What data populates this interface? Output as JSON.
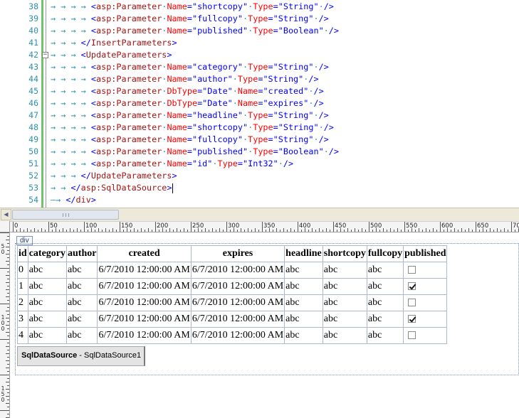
{
  "editor": {
    "lines": [
      {
        "n": "38",
        "indent": 4,
        "kind": "param",
        "attrs": [
          [
            "Name",
            "shortcopy"
          ],
          [
            "Type",
            "String"
          ]
        ]
      },
      {
        "n": "39",
        "indent": 4,
        "kind": "param",
        "attrs": [
          [
            "Name",
            "fullcopy"
          ],
          [
            "Type",
            "String"
          ]
        ]
      },
      {
        "n": "40",
        "indent": 4,
        "kind": "param",
        "attrs": [
          [
            "Name",
            "published"
          ],
          [
            "Type",
            "Boolean"
          ]
        ]
      },
      {
        "n": "41",
        "indent": 3,
        "kind": "close",
        "tag": "InsertParameters"
      },
      {
        "n": "42",
        "indent": 3,
        "kind": "open",
        "tag": "UpdateParameters",
        "fold": true
      },
      {
        "n": "43",
        "indent": 4,
        "kind": "param",
        "attrs": [
          [
            "Name",
            "category"
          ],
          [
            "Type",
            "String"
          ]
        ]
      },
      {
        "n": "44",
        "indent": 4,
        "kind": "param",
        "attrs": [
          [
            "Name",
            "author"
          ],
          [
            "Type",
            "String"
          ]
        ]
      },
      {
        "n": "45",
        "indent": 4,
        "kind": "param",
        "attrs": [
          [
            "DbType",
            "Date"
          ],
          [
            "Name",
            "created"
          ]
        ]
      },
      {
        "n": "46",
        "indent": 4,
        "kind": "param",
        "attrs": [
          [
            "DbType",
            "Date"
          ],
          [
            "Name",
            "expires"
          ]
        ]
      },
      {
        "n": "47",
        "indent": 4,
        "kind": "param",
        "attrs": [
          [
            "Name",
            "headline"
          ],
          [
            "Type",
            "String"
          ]
        ]
      },
      {
        "n": "48",
        "indent": 4,
        "kind": "param",
        "attrs": [
          [
            "Name",
            "shortcopy"
          ],
          [
            "Type",
            "String"
          ]
        ]
      },
      {
        "n": "49",
        "indent": 4,
        "kind": "param",
        "attrs": [
          [
            "Name",
            "fullcopy"
          ],
          [
            "Type",
            "String"
          ]
        ]
      },
      {
        "n": "50",
        "indent": 4,
        "kind": "param",
        "attrs": [
          [
            "Name",
            "published"
          ],
          [
            "Type",
            "Boolean"
          ]
        ]
      },
      {
        "n": "51",
        "indent": 4,
        "kind": "param",
        "attrs": [
          [
            "Name",
            "id"
          ],
          [
            "Type",
            "Int32"
          ]
        ]
      },
      {
        "n": "52",
        "indent": 3,
        "kind": "close",
        "tag": "UpdateParameters"
      },
      {
        "n": "53",
        "indent": 2,
        "kind": "close",
        "tag": "asp:SqlDataSource",
        "cursor": true
      },
      {
        "n": "54",
        "indent": 2,
        "kind": "close",
        "tag": "div",
        "leadDash": true
      }
    ],
    "param_tag": "asp:Parameter"
  },
  "ruler": {
    "labels": [
      "0",
      "50",
      "100",
      "150",
      "200",
      "250",
      "300",
      "350",
      "400",
      "450",
      "500",
      "550",
      "600",
      "650",
      "700"
    ],
    "vlabels": [
      "5",
      "0",
      "1",
      "0",
      "0",
      "1",
      "5",
      "0",
      "2",
      "0",
      "0",
      "2",
      "5",
      "0"
    ]
  },
  "design": {
    "div_tag": "div",
    "grid": {
      "headers": [
        "id",
        "category",
        "author",
        "created",
        "expires",
        "headline",
        "shortcopy",
        "fullcopy",
        "published"
      ],
      "rows": [
        {
          "id": "0",
          "category": "abc",
          "author": "abc",
          "created": "6/7/2010 12:00:00 AM",
          "expires": "6/7/2010 12:00:00 AM",
          "headline": "abc",
          "shortcopy": "abc",
          "fullcopy": "abc",
          "published": false
        },
        {
          "id": "1",
          "category": "abc",
          "author": "abc",
          "created": "6/7/2010 12:00:00 AM",
          "expires": "6/7/2010 12:00:00 AM",
          "headline": "abc",
          "shortcopy": "abc",
          "fullcopy": "abc",
          "published": true
        },
        {
          "id": "2",
          "category": "abc",
          "author": "abc",
          "created": "6/7/2010 12:00:00 AM",
          "expires": "6/7/2010 12:00:00 AM",
          "headline": "abc",
          "shortcopy": "abc",
          "fullcopy": "abc",
          "published": false
        },
        {
          "id": "3",
          "category": "abc",
          "author": "abc",
          "created": "6/7/2010 12:00:00 AM",
          "expires": "6/7/2010 12:00:00 AM",
          "headline": "abc",
          "shortcopy": "abc",
          "fullcopy": "abc",
          "published": true
        },
        {
          "id": "4",
          "category": "abc",
          "author": "abc",
          "created": "6/7/2010 12:00:00 AM",
          "expires": "6/7/2010 12:00:00 AM",
          "headline": "abc",
          "shortcopy": "abc",
          "fullcopy": "abc",
          "published": false
        }
      ]
    },
    "datasource": {
      "type_label": "SqlDataSource",
      "separator": " - ",
      "instance": "SqlDataSource1"
    }
  },
  "colors": {
    "line_numbers": "#2b91af",
    "tag": "#a31515",
    "attr": "#ff0000",
    "value": "#0000ff",
    "gutter_changed": "#6cc46c"
  },
  "icons": {
    "fold": "fold-minus-icon",
    "scroll_left": "arrow-left-icon",
    "scroll_right": "arrow-right-icon",
    "checkbox": "checkbox-icon"
  }
}
